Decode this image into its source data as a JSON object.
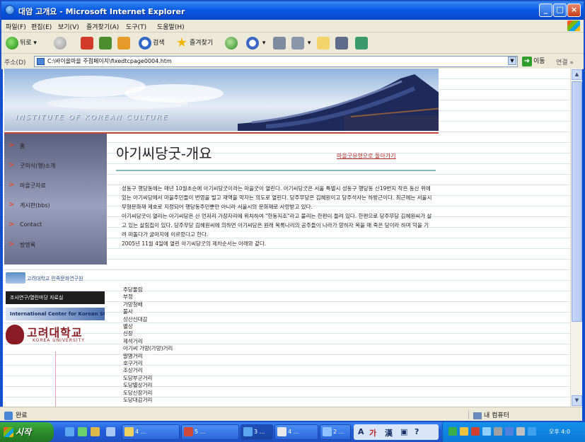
{
  "window": {
    "title": "대암 고개요 - Microsoft Internet Explorer",
    "min_label": "_",
    "max_label": "□",
    "close_label": "×"
  },
  "menu": [
    "파일(F)",
    "편집(E)",
    "보기(V)",
    "즐겨찾기(A)",
    "도구(T)",
    "도움말(H)"
  ],
  "toolbar": {
    "back_label": "뒤로",
    "search_label": "검색",
    "favorites_label": "즐겨찾기"
  },
  "address": {
    "label": "주소(D)",
    "value": "C:\\바이올마을 주점페이지\\fixedtcpage0004.htm",
    "go_label": "이동",
    "links_label": "연결 »"
  },
  "site": {
    "banner_name": "INSTITUTE OF KOREAN CULTURE",
    "nav": [
      "홈",
      "굿의식(행)소개",
      "마을굿자료",
      "게시판(bbs)",
      "Contact",
      "방명록"
    ],
    "logos": {
      "institute": "고려대학교 민족문화연구원",
      "black_banner": "조사연구/열린마당 자료실",
      "center": "International Center for Korean Studies",
      "university_ko": "고려대학교",
      "university_en": "KOREA UNIVERSITY"
    },
    "page_title": "아기씨당굿-개요",
    "back_link": "마을굿유형으로 돌아가기",
    "paragraphs": [
      "성동구 행당동에는 매년 10월초순에 아기씨당굿이라는 마을굿이 열린다. 아기씨당굿은 서울 특별시 성동구 행당동 산19번지 작은 동산 위에 있는 아기씨당에서 마을주민들이 번영을 빌고 재액을 막자는 의도로 열린다. 당주무당은 김혜원이고 당주석사는 하방근이다. 최근에는 서울시 무형문화재 제호로 지정되어 행당동주민뿐만 아니라 서울시의 문화재로 사랑받고 있다.",
      "아기씨당굿이 열리는 아기씨당은 산 언저리 가장자리에 위치하여 \"한동지조\"라고 불리는 한편이 들려 있다. 한편으로 당주무당 김혜원씨가 살고 있는 살림집이 있다. 당주무당 김혜원씨에 의하면 아기씨당은 원래 복록나리의 공주들이 나라가 망하자 목을 매 죽은 당이라 하며 덕을 기려 떠돌다가 굴마지에 이르렀다고 한다.",
      "2005년 11월 4일에 열린 아기씨당굿의 제차순서는 아래와 같다."
    ],
    "program": [
      "주당물림",
      "부정",
      "가망청배",
      "불사",
      "상산신대감",
      "별상",
      "신장",
      "제석거리",
      "아기씨 가망(가망)거리",
      "말명거리",
      "호구거리",
      "조상거리",
      "도당부군거리",
      "도당별상거리",
      "도당신장거리",
      "도당대감거리"
    ]
  },
  "status": {
    "left": "완료",
    "right": "내 컴퓨터"
  },
  "taskbar": {
    "start_label": "시작",
    "tasks": [
      "4 ...",
      "5 ...",
      "3 ...",
      "4 ...",
      "2 ..."
    ],
    "clock": "오후 4:0"
  }
}
